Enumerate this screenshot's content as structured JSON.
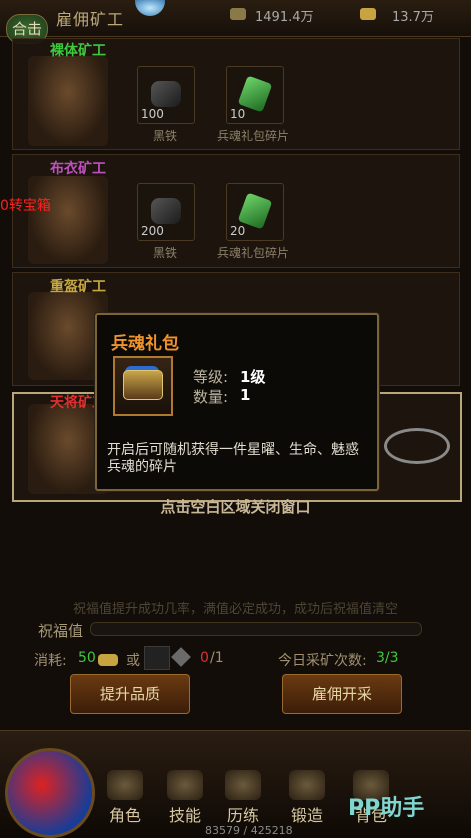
{
  "header": {
    "tag_label": "合击",
    "title": "雇佣矿工",
    "silver": "1491.4万",
    "gold": "13.7万"
  },
  "miners": [
    {
      "name": "裸体矿工",
      "name_color": "#3ec83e",
      "items": [
        {
          "count": "100",
          "name": "黑铁",
          "icon": "ore-icon"
        },
        {
          "count": "10",
          "name": "兵魂礼包碎片",
          "icon": "gem-icon"
        }
      ]
    },
    {
      "name": "布衣矿工",
      "name_color": "#c050c0",
      "items": [
        {
          "count": "200",
          "name": "黑铁",
          "icon": "ore-icon"
        },
        {
          "count": "20",
          "name": "兵魂礼包碎片",
          "icon": "gem-icon"
        }
      ]
    },
    {
      "name": "重盔矿工",
      "name_color": "#c8a840",
      "items": []
    },
    {
      "name": "天将矿工",
      "name_color": "#e03030",
      "items": []
    }
  ],
  "side_label": "0转宝箱",
  "popup": {
    "title": "兵魂礼包",
    "level_label": "等级:",
    "level_value": "1级",
    "qty_label": "数量:",
    "qty_value": "1",
    "description": "开启后可随机获得一件星曜、生命、魅惑兵魂的碎片",
    "icon": "chest-icon"
  },
  "close_hint": "点击空白区域关闭窗口",
  "bless": {
    "hint": "祝福值提升成功几率，满值必定成功，成功后祝福值清空",
    "label": "祝福值"
  },
  "cost": {
    "label": "消耗:",
    "gold_amount": "50",
    "or_label": "或",
    "item_count": "0",
    "item_need": "/1"
  },
  "mining_count": {
    "label": "今日采矿次数:",
    "value": "3/3"
  },
  "buttons": {
    "upgrade": "提升品质",
    "hire": "雇佣开采"
  },
  "nav": [
    {
      "label": "角色",
      "icon": "character-icon"
    },
    {
      "label": "技能",
      "icon": "skill-icon"
    },
    {
      "label": "历练",
      "icon": "training-icon"
    },
    {
      "label": "锻造",
      "icon": "forge-icon"
    },
    {
      "label": "背包",
      "icon": "bag-icon"
    }
  ],
  "exp": "83579 / 425218",
  "watermark": "PP助手"
}
